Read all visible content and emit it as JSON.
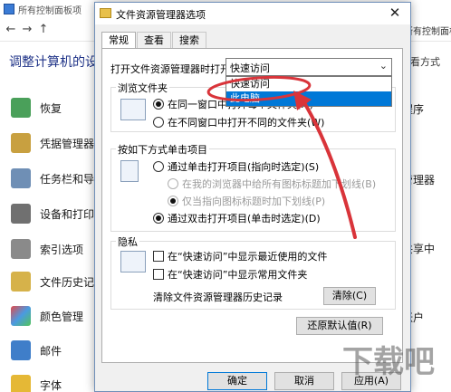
{
  "bg": {
    "title": "所有控制面板项",
    "crumb_tail": "所有控制面板项",
    "heading": "调整计算机的设置",
    "viewby": "查看方式",
    "left_items": [
      "恢复",
      "凭据管理器",
      "任务栏和导航",
      "设备和打印机",
      "索引选项",
      "文件历史记录",
      "颜色管理",
      "邮件",
      "字体"
    ],
    "right_items": [
      "程序",
      "管理器",
      "共享中",
      "帐户"
    ]
  },
  "dialog": {
    "title": "文件资源管理器选项",
    "tabs": [
      "常规",
      "查看",
      "搜索"
    ],
    "open_label": "打开文件资源管理器时打开:",
    "open_value": "快速访问",
    "options": [
      "快速访问",
      "此电脑"
    ],
    "browse": {
      "title": "浏览文件夹",
      "opt1": "在同一窗口中打开每个文件夹(M)",
      "opt2": "在不同窗口中打开不同的文件夹(W)"
    },
    "click": {
      "title": "按如下方式单击项目",
      "single": "通过单击打开项目(指向时选定)(S)",
      "sub1": "在我的浏览器中给所有图标标题加下划线(B)",
      "sub2": "仅当指向图标标题时加下划线(P)",
      "double": "通过双击打开项目(单击时选定)(D)"
    },
    "privacy": {
      "title": "隐私",
      "recent": "在“快速访问”中显示最近使用的文件",
      "frequent": "在“快速访问”中显示常用文件夹",
      "clear_label": "清除文件资源管理器历史记录",
      "clear_btn": "清除(C)"
    },
    "restore_btn": "还原默认值(R)",
    "ok": "确定",
    "cancel": "取消",
    "apply": "应用(A)"
  },
  "watermark": "下载吧",
  "colors": {
    "accent": "#0078d7",
    "annotation": "#d9343a",
    "heading": "#1e3287"
  }
}
